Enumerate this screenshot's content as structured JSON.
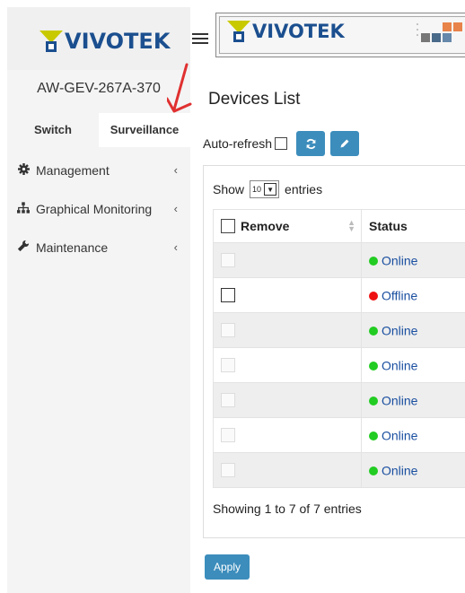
{
  "brand": {
    "logo_text": "VIVOTEK"
  },
  "sidebar": {
    "device_name": "AW-GEV-267A-370",
    "tabs": [
      {
        "label": "Switch"
      },
      {
        "label": "Surveillance"
      }
    ],
    "menu": [
      {
        "label": "Management",
        "icon": "gear-icon"
      },
      {
        "label": "Graphical Monitoring",
        "icon": "sitemap-icon"
      },
      {
        "label": "Maintenance",
        "icon": "wrench-icon"
      }
    ]
  },
  "main": {
    "title": "Devices List",
    "auto_refresh_label": "Auto-refresh",
    "show_label": "Show",
    "entries_label": "entries",
    "page_size": "10",
    "columns": {
      "remove": "Remove",
      "status": "Status"
    },
    "rows": [
      {
        "status": "Online",
        "color": "#22cc22"
      },
      {
        "status": "Offline",
        "color": "#ee1111"
      },
      {
        "status": "Online",
        "color": "#22cc22"
      },
      {
        "status": "Online",
        "color": "#22cc22"
      },
      {
        "status": "Online",
        "color": "#22cc22"
      },
      {
        "status": "Online",
        "color": "#22cc22"
      },
      {
        "status": "Online",
        "color": "#22cc22"
      }
    ],
    "info": "Showing 1 to 7 of 7 entries",
    "apply_label": "Apply"
  },
  "colors": {
    "accent": "#3c8dbc",
    "brand_blue": "#1b4f8f",
    "brand_yellow": "#c9c900"
  }
}
